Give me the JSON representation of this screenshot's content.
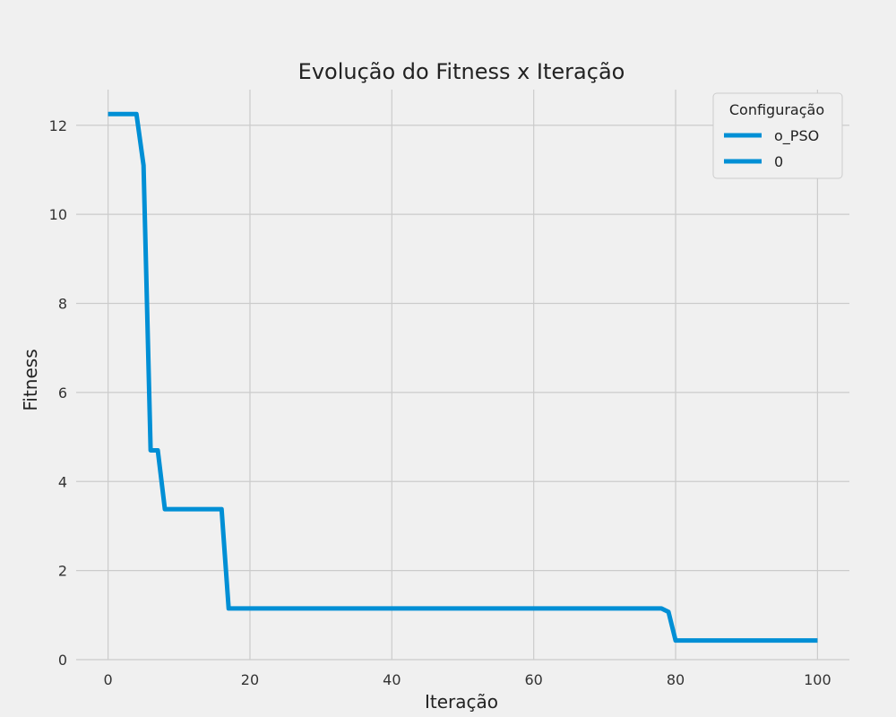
{
  "chart_data": {
    "type": "line",
    "title": "Evolução do Fitness x Iteração",
    "xlabel": "Iteração",
    "ylabel": "Fitness",
    "xlim": [
      -4.5,
      104.5
    ],
    "ylim": [
      0,
      12.8
    ],
    "xticks": [
      0,
      20,
      40,
      60,
      80,
      100
    ],
    "yticks": [
      0,
      2,
      4,
      6,
      8,
      10,
      12
    ],
    "grid": true,
    "legend": {
      "title": "Configuração",
      "placement": "top-right",
      "entries": [
        "o_PSO",
        "0"
      ]
    },
    "colors": {
      "series": "#008fd5",
      "grid": "#cbcbcb",
      "background": "#f0f0f0"
    },
    "series": [
      {
        "name": "o_PSO",
        "x": [
          0,
          1,
          2,
          3,
          4,
          5,
          6,
          7,
          8,
          9,
          10,
          11,
          12,
          13,
          14,
          15,
          16,
          17,
          18,
          20,
          30,
          40,
          50,
          60,
          70,
          77,
          78,
          79,
          80,
          81,
          90,
          100
        ],
        "y": [
          12.25,
          12.25,
          12.25,
          12.25,
          12.25,
          11.1,
          4.7,
          4.7,
          3.38,
          3.38,
          3.38,
          3.38,
          3.38,
          3.38,
          3.38,
          3.38,
          3.38,
          1.15,
          1.15,
          1.15,
          1.15,
          1.15,
          1.15,
          1.15,
          1.15,
          1.15,
          1.15,
          1.07,
          0.43,
          0.43,
          0.43,
          0.43
        ]
      }
    ]
  }
}
